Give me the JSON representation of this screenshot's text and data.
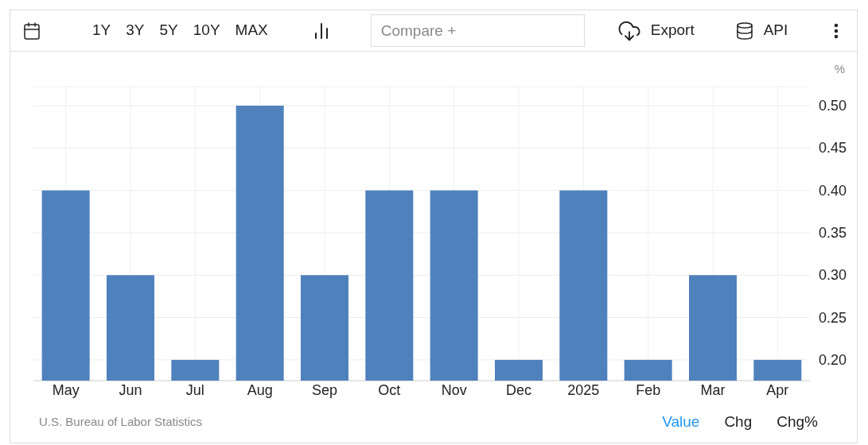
{
  "toolbar": {
    "ranges": [
      {
        "label": "1Y",
        "selected": false
      },
      {
        "label": "3Y",
        "selected": false
      },
      {
        "label": "5Y",
        "selected": false
      },
      {
        "label": "10Y",
        "selected": false
      },
      {
        "label": "MAX",
        "selected": false
      }
    ],
    "compare": {
      "placeholder": "Compare +"
    },
    "export": "Export",
    "api": "API"
  },
  "chart": {
    "unit": "%",
    "chart_data": {
      "type": "bar",
      "categories": [
        "May",
        "Jun",
        "Jul",
        "Aug",
        "Sep",
        "Oct",
        "Nov",
        "Dec",
        "2025",
        "Feb",
        "Mar",
        "Apr"
      ],
      "grid": true,
      "series": [
        {
          "color": "#4f81bd",
          "values": [
            0.4,
            0.3,
            0.2,
            0.5,
            0.3,
            0.4,
            0.4,
            0.2,
            0.4,
            0.2,
            0.3,
            0.2
          ]
        }
      ],
      "ylim": [
        0.1755,
        0.5225
      ],
      "yticks": [
        {
          "value": 0.2,
          "label": "0.20"
        },
        {
          "value": 0.25,
          "label": "0.25"
        },
        {
          "value": 0.3,
          "label": "0.30"
        },
        {
          "value": 0.35,
          "label": "0.35"
        },
        {
          "value": 0.4,
          "label": "0.40"
        },
        {
          "value": 0.45,
          "label": "0.45"
        },
        {
          "value": 0.5,
          "label": "0.50"
        }
      ]
    }
  },
  "footer": {
    "source": "U.S. Bureau of Labor Statistics",
    "modes": [
      {
        "label": "Value",
        "selected": true
      },
      {
        "label": "Chg",
        "selected": false
      },
      {
        "label": "Chg%",
        "selected": false
      }
    ]
  }
}
